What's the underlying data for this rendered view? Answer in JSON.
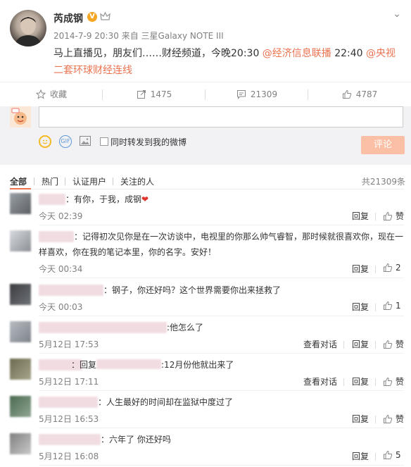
{
  "post": {
    "author": "芮成钢",
    "verified_badge": "V",
    "timestamp": "2014-7-9 20:30",
    "source_prefix": "来自",
    "source": "三星Galaxy NOTE III",
    "text_part1": "马上直播见，朋友们……财经频道，今晚20:30 ",
    "mention1": "@经济信息联播",
    "text_part2": " 22:40 ",
    "mention2": "@央视二套环球财经连线",
    "menu_icon": "chevron-down-icon",
    "accent_color": "#eb7350"
  },
  "actions": {
    "favorite": {
      "icon": "star-icon",
      "label": "收藏"
    },
    "repost": {
      "icon": "repost-icon",
      "count": "1475"
    },
    "comment": {
      "icon": "comment-icon",
      "count": "21309"
    },
    "like": {
      "icon": "thumbs-up-icon",
      "count": "4787"
    }
  },
  "compose": {
    "placeholder": "",
    "repost_checkbox_label": "同时转发到我的微博",
    "submit_label": "评论",
    "gif_label": "GIF"
  },
  "filter": {
    "tabs": [
      "全部",
      "热门",
      "认证用户",
      "关注的人"
    ],
    "active_tab": "全部",
    "total": "共21309条"
  },
  "comments": [
    {
      "text": "：有你，于我，成钢",
      "heart": "❤",
      "time": "今天 02:39",
      "reply": "回复",
      "like": "赞",
      "like_count": "",
      "view_conversation": ""
    },
    {
      "text": "：记得初次见你是在一次访谈中，电视里的你那么帅气睿智，那时候就很喜欢你，现在一样喜欢，你在我的笔记本里，你的名字。安好！",
      "heart": "",
      "time": "今天 00:34",
      "reply": "回复",
      "like": "",
      "like_count": "2",
      "view_conversation": ""
    },
    {
      "text": "：钢子，你还好吗？这个世界需要你出来拯救了",
      "heart": "",
      "time": "今天 00:03",
      "reply": "回复",
      "like": "",
      "like_count": "1",
      "view_conversation": ""
    },
    {
      "text": ":他怎么了",
      "heart": "",
      "time": "5月12日 17:53",
      "reply": "回复",
      "like": "赞",
      "like_count": "",
      "view_conversation": "查看对话"
    },
    {
      "text_prefix": "：回复",
      "text": ":12月份他就出来了",
      "heart": "",
      "time": "5月12日 17:11",
      "reply": "回复",
      "like": "赞",
      "like_count": "",
      "view_conversation": "查看对话"
    },
    {
      "text": "：人生最好的时间却在监狱中度过了",
      "heart": "",
      "time": "5月12日 16:53",
      "reply": "回复",
      "like": "赞",
      "like_count": "",
      "view_conversation": ""
    },
    {
      "text": "：六年了 你还好吗",
      "heart": "",
      "time": "5月12日 16:08",
      "reply": "回复",
      "like": "",
      "like_count": "5",
      "view_conversation": ""
    }
  ]
}
